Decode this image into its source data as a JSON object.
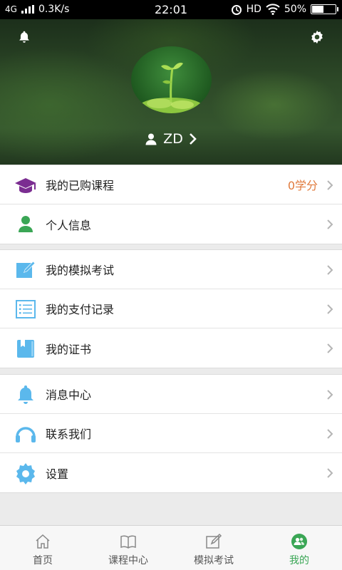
{
  "status_bar": {
    "network": "4G",
    "speed": "0.3K/s",
    "time": "22:01",
    "hd": "HD",
    "battery": "50%",
    "battery_level": 0.5
  },
  "profile": {
    "username": "ZD"
  },
  "menu": {
    "group1": [
      {
        "label": "我的已购课程",
        "value": "0学分",
        "icon": "graduation-cap-icon",
        "color": "#7b2d91"
      },
      {
        "label": "个人信息",
        "icon": "person-icon",
        "color": "#3aa655"
      }
    ],
    "group2": [
      {
        "label": "我的模拟考试",
        "icon": "edit-note-icon",
        "color": "#5bb8ec"
      },
      {
        "label": "我的支付记录",
        "icon": "list-icon",
        "color": "#5bb8ec"
      },
      {
        "label": "我的证书",
        "icon": "certificate-book-icon",
        "color": "#5bb8ec"
      }
    ],
    "group3": [
      {
        "label": "消息中心",
        "icon": "bell-icon",
        "color": "#5bb8ec"
      },
      {
        "label": "联系我们",
        "icon": "headset-icon",
        "color": "#5bb8ec"
      },
      {
        "label": "设置",
        "icon": "gear-icon",
        "color": "#5bb8ec"
      }
    ]
  },
  "tabs": [
    {
      "label": "首页",
      "icon": "home-icon",
      "active": false
    },
    {
      "label": "课程中心",
      "icon": "book-icon",
      "active": false
    },
    {
      "label": "模拟考试",
      "icon": "exam-icon",
      "active": false
    },
    {
      "label": "我的",
      "icon": "profile-icon",
      "active": true
    }
  ],
  "colors": {
    "accent": "#3aa655",
    "credit_orange": "#e07a3c",
    "icon_blue": "#5bb8ec",
    "icon_purple": "#7b2d91"
  }
}
